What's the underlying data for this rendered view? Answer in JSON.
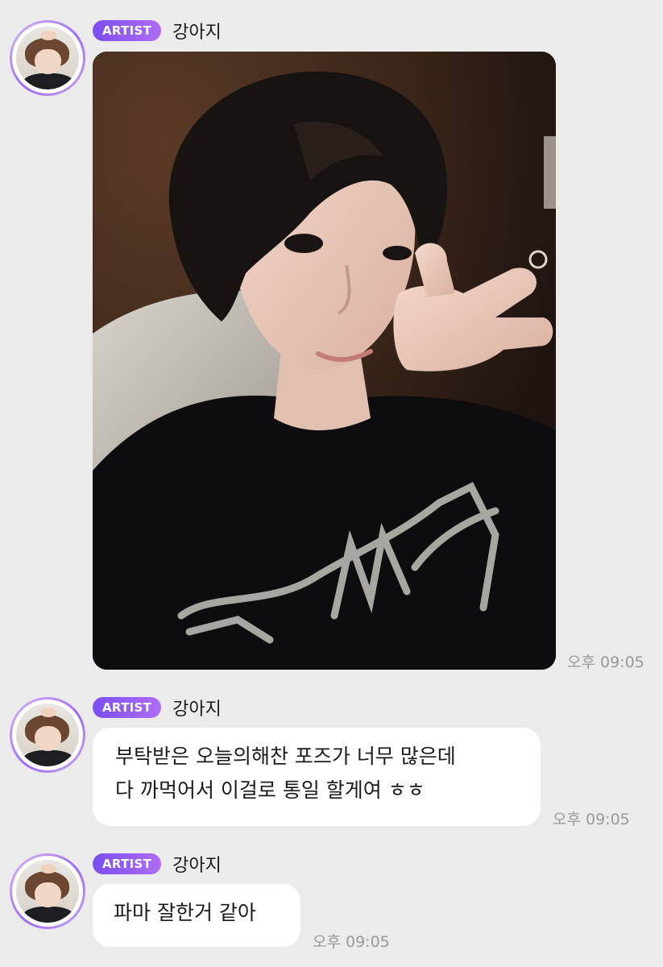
{
  "messages": [
    {
      "badge": "ARTIST",
      "name": "강아지",
      "type": "photo",
      "time": "오후 09:05"
    },
    {
      "badge": "ARTIST",
      "name": "강아지",
      "type": "text",
      "lines": [
        "부탁받은 오늘의해찬 포즈가 너무 많은데",
        "다 까먹어서 이걸로 통일 할게여 ㅎㅎ"
      ],
      "time": "오후 09:05"
    },
    {
      "badge": "ARTIST",
      "name": "강아지",
      "type": "text",
      "lines": [
        "파마 잘한거 같아"
      ],
      "time": "오후 09:05"
    }
  ],
  "colors": {
    "background": "#ebebeb",
    "badge_start": "#7a4ef3",
    "badge_end": "#b06cf4",
    "bubble": "#ffffff",
    "time": "#9a9a9a"
  },
  "icons": {
    "avatar": "profile-photo"
  }
}
